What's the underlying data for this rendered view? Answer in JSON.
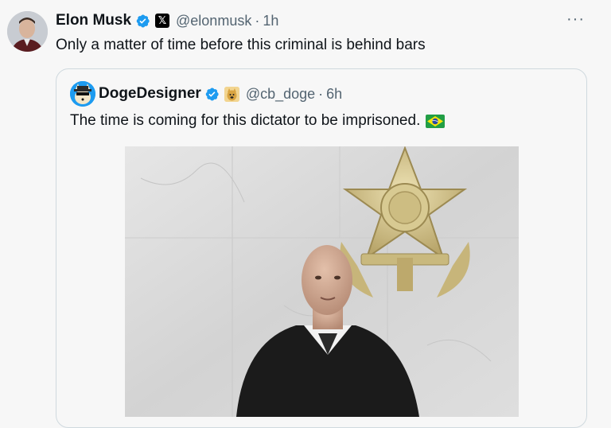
{
  "tweet": {
    "author_name": "Elon Musk",
    "handle": "@elonmusk",
    "separator": "·",
    "time": "1h",
    "text": "Only a matter of time before this criminal is behind bars",
    "affiliation_glyph": "𝕏",
    "more_glyph": "···"
  },
  "quote": {
    "author_name": "DogeDesigner",
    "handle": "@cb_doge",
    "separator": "·",
    "time": "6h",
    "text": "The time is coming for this dictator to be imprisoned.",
    "flag_icon": "brazil-flag-icon"
  },
  "colors": {
    "background": "#f7f7f7",
    "text": "#0f1419",
    "muted": "#536471",
    "verified": "#1d9bf0",
    "border": "#cfd9de"
  }
}
